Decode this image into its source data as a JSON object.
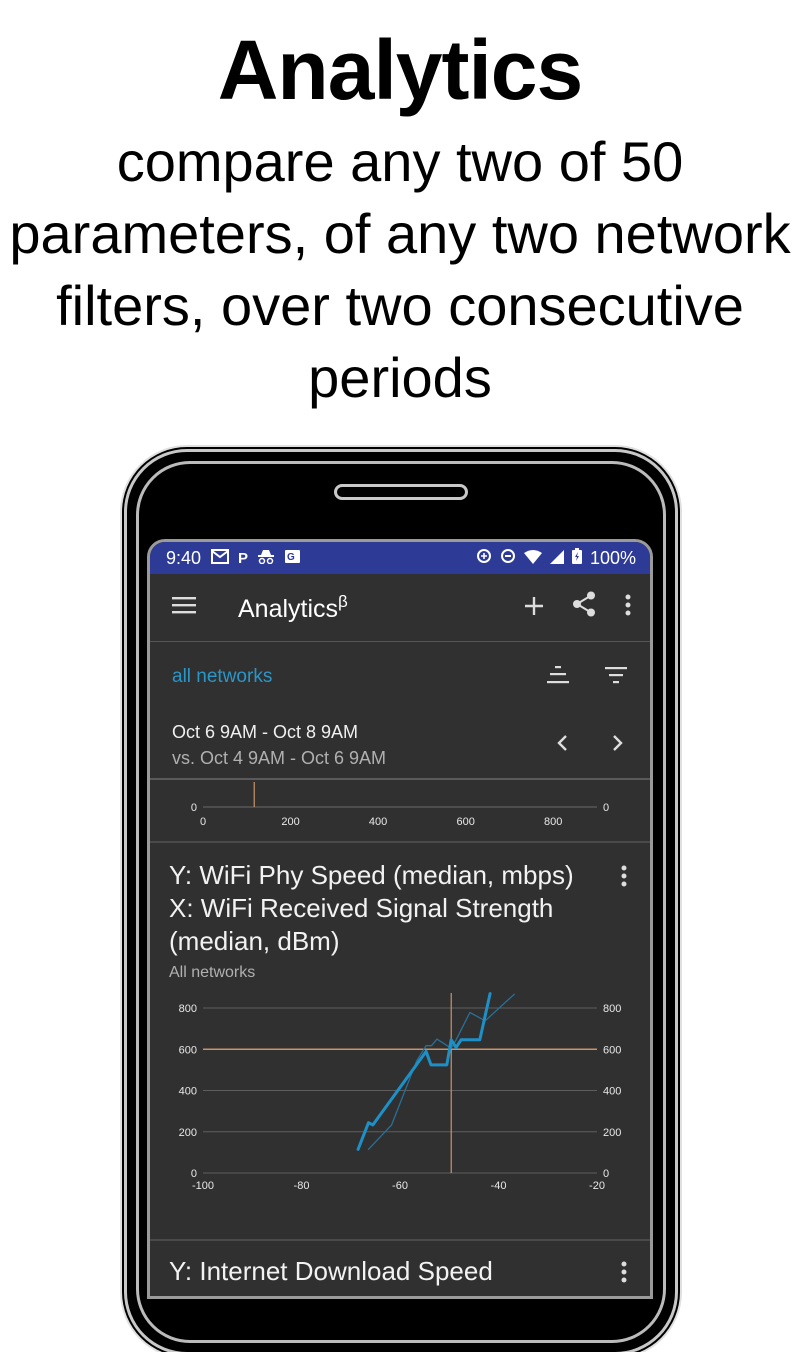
{
  "promo": {
    "headline": "Analytics",
    "subheadline_lines": [
      "compare any two of 50",
      "parameters, of any two network",
      "filters, over two consecutive",
      "periods"
    ]
  },
  "status_bar": {
    "time": "9:40",
    "left_icons": [
      "gmail-icon",
      "parking-icon",
      "incognito-icon",
      "translate-icon"
    ],
    "right_icons": [
      "data-saver-icon",
      "do-not-disturb-icon",
      "wifi-icon",
      "cellular-signal-icon",
      "battery-charging-icon"
    ],
    "battery": "100%",
    "color": "#2d3a96"
  },
  "toolbar": {
    "title": "Analytics",
    "title_superscript": "β",
    "menu_icon": "hamburger-menu-icon",
    "actions": [
      "add-icon",
      "share-icon",
      "more-vert-icon"
    ]
  },
  "filter": {
    "label": "all networks",
    "color": "#2a96c8",
    "icons": [
      "aggregation-icon",
      "filter-icon"
    ]
  },
  "period": {
    "current": "Oct 6 9AM - Oct 8 9AM",
    "comparison": "vs. Oct 4 9AM - Oct 6 9AM",
    "prev_icon": "chevron-left-icon",
    "next_icon": "chevron-right-icon"
  },
  "cards": [
    {
      "title": "Y: Internet Download Speed",
      "partial": true
    },
    {
      "title_line1": "Y: WiFi Phy Speed (median, mbps)",
      "title_line2": "X: WiFi Received Signal Strength",
      "title_line3": "(median, dBm)",
      "subtitle": "All networks"
    }
  ],
  "chart_data": [
    {
      "type": "line",
      "title": "",
      "note": "bottom strip of a previous, mostly scrolled-off chart",
      "x_ticks": [
        "0",
        "200",
        "400",
        "600",
        "800"
      ],
      "y_ticks_left": [
        "0"
      ],
      "y_ticks_right": [
        "0"
      ],
      "xlim": [
        0,
        900
      ],
      "ylim": [
        0,
        0
      ],
      "crosshair_x": 117,
      "series": []
    },
    {
      "type": "line",
      "title": "Y: WiFi Phy Speed (median, mbps) / X: WiFi Received Signal Strength (median, dBm)",
      "xlabel": "WiFi Received Signal Strength (median, dBm)",
      "ylabel": "WiFi Phy Speed (median, mbps)",
      "xlim": [
        -100,
        -20
      ],
      "ylim": [
        0,
        800
      ],
      "x_ticks": [
        "-100",
        "-80",
        "-60",
        "-40",
        "-20"
      ],
      "y_ticks_left": [
        "0",
        "200",
        "400",
        "600",
        "800"
      ],
      "y_ticks_right": [
        "0",
        "200",
        "400",
        "600",
        "800"
      ],
      "grid": true,
      "crosshair": {
        "x": -49.6,
        "y": 600,
        "color": "#c8946a"
      },
      "series": [
        {
          "name": "current period",
          "color": "#1e90c8",
          "emphasis": "thick",
          "points": [
            [
              -68.5,
              115
            ],
            [
              -66.4,
              244
            ],
            [
              -65.5,
              233
            ],
            [
              -54.7,
              589
            ],
            [
              -53.7,
              524
            ],
            [
              -50.5,
              524
            ],
            [
              -49.6,
              646
            ],
            [
              -48.6,
              608
            ],
            [
              -47.6,
              646
            ],
            [
              -43.8,
              646
            ],
            [
              -41.7,
              870
            ]
          ]
        },
        {
          "name": "comparison period",
          "color": "#2a6f96",
          "emphasis": "thin",
          "points": [
            [
              -66.4,
              115
            ],
            [
              -61.7,
              233
            ],
            [
              -56.6,
              544
            ],
            [
              -54.7,
              617
            ],
            [
              -53.6,
              617
            ],
            [
              -52.5,
              649
            ],
            [
              -49.6,
              605
            ],
            [
              -48.6,
              646
            ],
            [
              -45.8,
              778
            ],
            [
              -42.7,
              738
            ],
            [
              -36.8,
              867
            ]
          ]
        }
      ]
    }
  ]
}
